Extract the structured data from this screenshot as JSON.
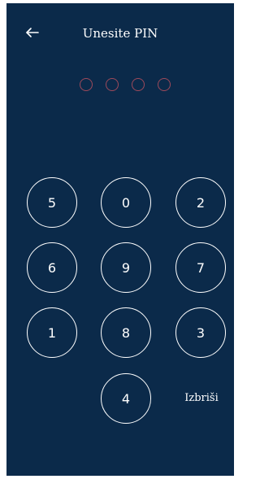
{
  "header": {
    "title": "Unesite PIN",
    "back_icon": "arrow-left-icon"
  },
  "pin": {
    "length": 4,
    "filled": 0,
    "dot_color": "#9e4a5b"
  },
  "keypad": {
    "keys": [
      "5",
      "0",
      "2",
      "6",
      "9",
      "7",
      "1",
      "8",
      "3",
      "4"
    ],
    "delete_label": "Izbriši"
  },
  "colors": {
    "background": "#0b2a4a",
    "foreground": "#ffffff"
  }
}
